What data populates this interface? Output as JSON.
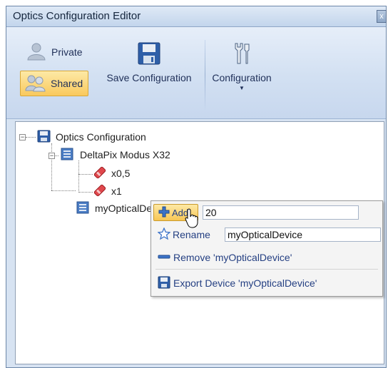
{
  "window": {
    "title": "Optics Configuration Editor",
    "close_glyph": "x"
  },
  "ribbon": {
    "private_label": "Private",
    "shared_label": "Shared",
    "save_label": "Save Configuration",
    "configuration_label": "Configuration"
  },
  "tree": {
    "root_label": "Optics Configuration",
    "device1_label": "DeltaPix Modus X32",
    "lens1_label": "x0,5",
    "lens2_label": "x1",
    "device2_label": "myOpticalDevic"
  },
  "context_menu": {
    "add_label": "Add",
    "add_value": "20",
    "rename_label": "Rename",
    "rename_value": "myOpticalDevice",
    "remove_label": "Remove 'myOpticalDevice'",
    "export_label": "Export Device 'myOpticalDevice'"
  }
}
